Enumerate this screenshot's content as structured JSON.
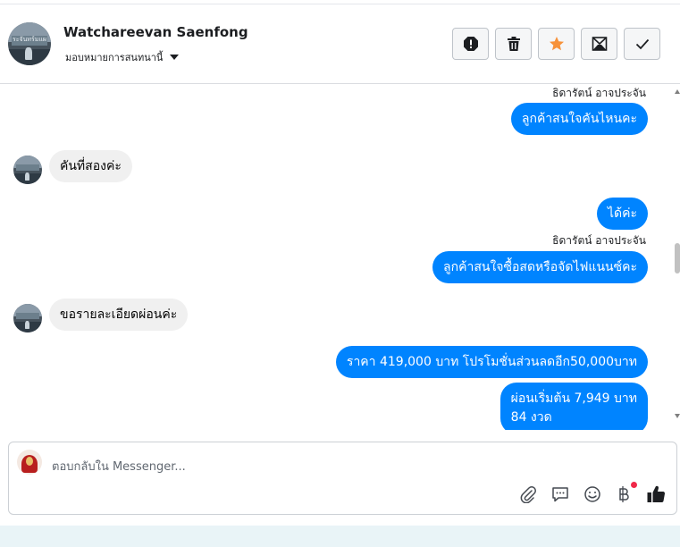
{
  "header": {
    "contact_name": "Watchareevan Saenfong",
    "assign_label": "มอบหมายการสนทนานี้",
    "avatar_sign_text": "ระจันทร์มแผ",
    "actions": [
      {
        "name": "report-spam",
        "icon": "alert-octagon-icon"
      },
      {
        "name": "delete",
        "icon": "trash-icon"
      },
      {
        "name": "star",
        "icon": "star-icon",
        "color": "#f7923a"
      },
      {
        "name": "mark-unread",
        "icon": "mail-icon"
      },
      {
        "name": "mark-done",
        "icon": "check-icon"
      }
    ]
  },
  "messages": [
    {
      "direction": "out",
      "sender": "ธิดารัตน์ อาจประจัน",
      "text": "ลูกค้าสนใจคันไหนคะ"
    },
    {
      "direction": "in",
      "text": "คันที่สองค่ะ"
    },
    {
      "direction": "out",
      "text": "ได้ค่ะ"
    },
    {
      "direction": "out",
      "sender": "ธิดารัตน์ อาจประจัน",
      "text": "ลูกค้าสนใจซื้อสดหรือจัดไฟแนนซ์คะ"
    },
    {
      "direction": "in",
      "text": "ขอรายละเอียดผ่อนค่ะ"
    },
    {
      "direction": "out",
      "text": "ราคา 419,000 บาท โปรโมชั่นส่วนลดอีก50,000บาท"
    },
    {
      "direction": "out",
      "text_line1": "ผ่อนเริ่มต้น 7,949 บาท",
      "text_line2": "84 งวด"
    }
  ],
  "composer": {
    "placeholder": "ตอบกลับใน Messenger...",
    "tools": [
      "paperclip-icon",
      "saved-reply-icon",
      "emoji-icon",
      "baht-payment-icon",
      "thumbs-up-icon"
    ]
  },
  "colors": {
    "outgoing_bubble": "#0084ff",
    "incoming_bubble": "#f0f0f0",
    "star": "#f7923a",
    "notification_dot": "#f02849"
  }
}
